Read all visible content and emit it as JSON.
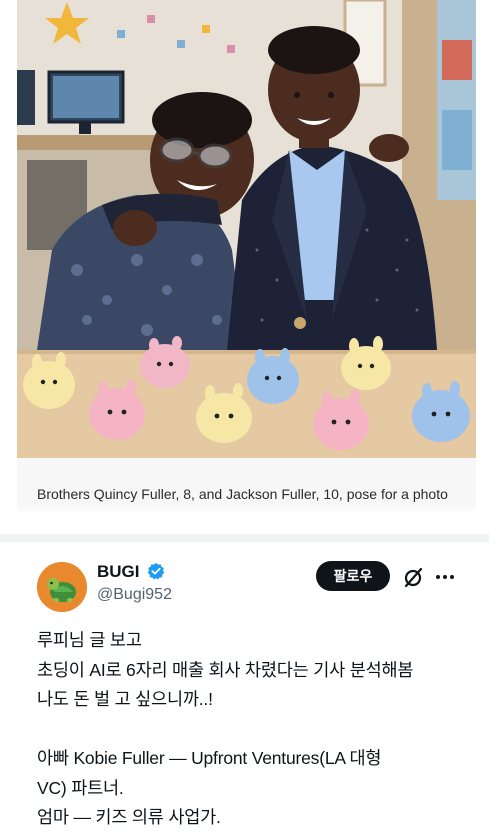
{
  "photo": {
    "caption": "Brothers Quincy Fuller, 8, and Jackson Fuller, 10, pose for a photo"
  },
  "tweet": {
    "author": {
      "display_name": "BUGI",
      "handle": "@Bugi952",
      "avatar_icon": "turtle-avatar-icon",
      "verified_icon": "verified-badge-icon",
      "verified_color": "#1d9bf0",
      "avatar_color": "#e8892e"
    },
    "follow_label": "팔로우",
    "grok_icon": "grok-icon",
    "more_icon": "more-icon",
    "lines": [
      "루피님 글 보고",
      "초딩이 AI로 6자리 매출 회사 차렸다는 기사 분석해봄",
      "나도 돈 벌 고 싶으니까..!",
      "",
      "아빠 Kobie Fuller — Upfront Ventures(LA 대형",
      "VC) 파트너.",
      "엄마 — 키즈 의류 사업가."
    ]
  }
}
